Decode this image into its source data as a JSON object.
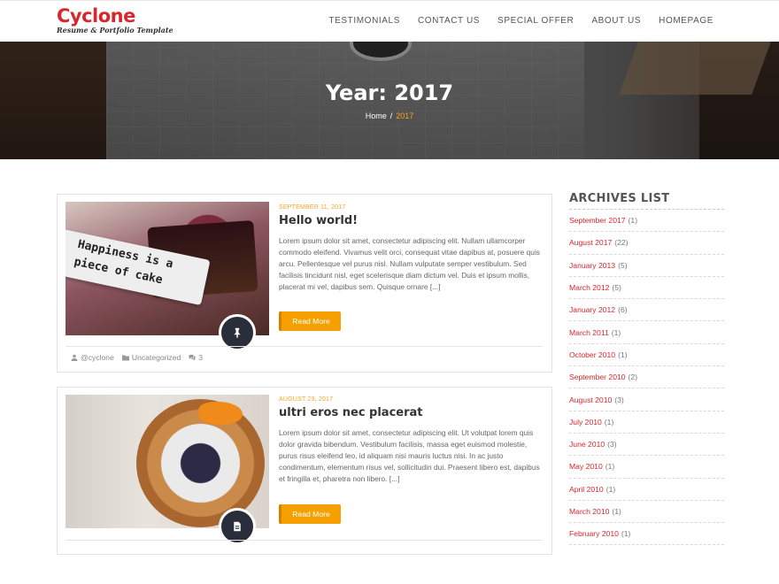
{
  "brand": {
    "title": "Cyclone",
    "subtitle": "Resume & Portfolio Template"
  },
  "nav": [
    "TESTIMONIALS",
    "CONTACT US",
    "SPECIAL OFFER",
    "ABOUT US",
    "HOMEPAGE"
  ],
  "hero": {
    "title": "Year: 2017",
    "breadcrumb_home": "Home",
    "breadcrumb_sep": "/",
    "breadcrumb_current": "2017"
  },
  "posts": [
    {
      "date": "SEPTEMBER 11, 2017",
      "title": "Hello world!",
      "excerpt": "Lorem ipsum dolor sit amet, consectetur adipiscing elit. Nullam ullamcorper commodo eleifend. Vivamus velit orci, consequat vitae dapibus at, posuere quis arcu. Pellentesque vel purus nisl. Nullam vulputate semper vestibulum. Sed facilisis tincidunt nisl, eget scelerisque diam dictum vel. Duis et ipsum mollis, placerat mi vel, dapibus sem. Quisque ornare [...]",
      "button": "Read More",
      "image_text": "Happiness is a piece of cake",
      "badge_icon": "pin-icon",
      "author": "@cyclone",
      "category": "Uncategorized",
      "comments": "3"
    },
    {
      "date": "AUGUST 23, 2017",
      "title": "ultri eros nec placerat",
      "excerpt": "Lorem ipsum dolor sit amet, consectetur adipiscing elit. Ut volutpat lorem quis dolor gravida bibendum. Vestibulum facilisis, massa eget euismod molestie, purus risus eleifend leo, id aliquam nisi mauris luctus nisi. In ac justo condimentum, elementum risus vel, sollicitudin dui. Praesent libero est, dapibus et fringilla et, pharetra non libero. [...]",
      "button": "Read More",
      "badge_icon": "document-icon"
    }
  ],
  "sidebar": {
    "title": "ARCHIVES LIST",
    "items": [
      {
        "label": "September 2017",
        "count": "(1)"
      },
      {
        "label": "August 2017",
        "count": "(22)"
      },
      {
        "label": "January 2013",
        "count": "(5)"
      },
      {
        "label": "March 2012",
        "count": "(5)"
      },
      {
        "label": "January 2012",
        "count": "(6)"
      },
      {
        "label": "March 2011",
        "count": "(1)"
      },
      {
        "label": "October 2010",
        "count": "(1)"
      },
      {
        "label": "September 2010",
        "count": "(2)"
      },
      {
        "label": "August 2010",
        "count": "(3)"
      },
      {
        "label": "July 2010",
        "count": "(1)"
      },
      {
        "label": "June 2010",
        "count": "(3)"
      },
      {
        "label": "May 2010",
        "count": "(1)"
      },
      {
        "label": "April 2010",
        "count": "(1)"
      },
      {
        "label": "March 2010",
        "count": "(1)"
      },
      {
        "label": "February 2010",
        "count": "(1)"
      }
    ]
  },
  "colors": {
    "brand_red": "#d9262c",
    "accent_orange": "#f5a623",
    "button_orange": "#f5a000",
    "badge_dark": "#2a2d3a"
  }
}
